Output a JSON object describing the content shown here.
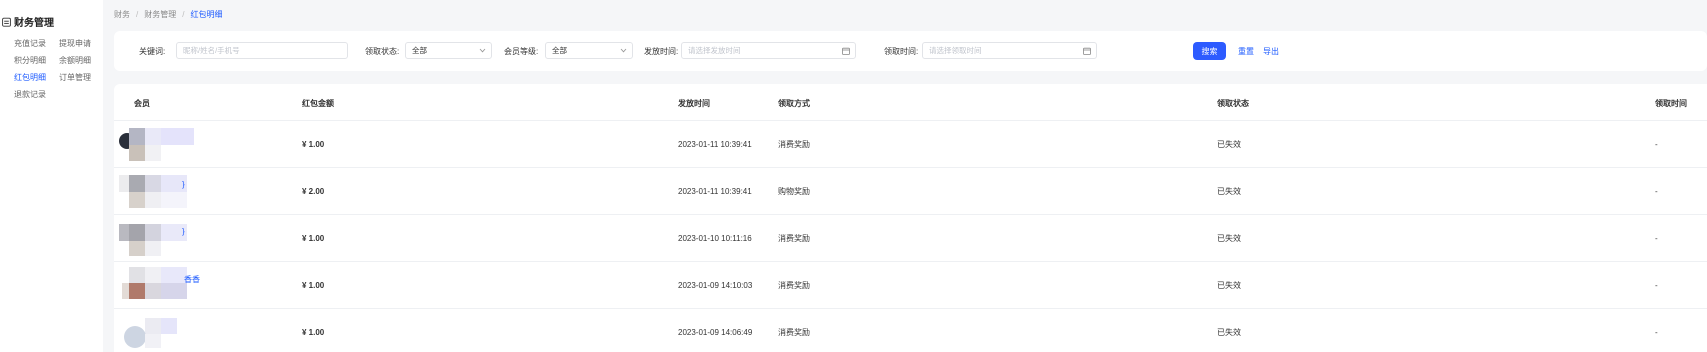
{
  "sidebar": {
    "title": "财务管理",
    "items": [
      {
        "label": "充值记录",
        "active": false
      },
      {
        "label": "提现申请",
        "active": false
      },
      {
        "label": "积分明细",
        "active": false
      },
      {
        "label": "余额明细",
        "active": false
      },
      {
        "label": "红包明细",
        "active": true
      },
      {
        "label": "订单管理",
        "active": false
      },
      {
        "label": "退款记录",
        "active": false
      }
    ]
  },
  "breadcrumb": [
    "财务",
    "财务管理",
    "红包明细"
  ],
  "filters": {
    "keyword_label": "关键词:",
    "keyword_placeholder": "昵称/姓名/手机号",
    "claim_status_label": "领取状态:",
    "claim_status_value": "全部",
    "member_level_label": "会员等级:",
    "member_level_value": "全部",
    "issue_time_label": "发放时间:",
    "issue_time_placeholder": "请选择发放时间",
    "claim_time_label": "领取时间:",
    "claim_time_placeholder": "请选择领取时间",
    "search_label": "搜索",
    "reset_label": "重置",
    "export_label": "导出"
  },
  "table": {
    "headers": [
      "会员",
      "红包金额",
      "发放时间",
      "领取方式",
      "领取状态",
      "领取时间"
    ],
    "rows": [
      {
        "member_suffix": "",
        "amount": "¥ 1.00",
        "issue_time": "2023-01-11 10:39:41",
        "method": "消费奖励",
        "status": "已失效",
        "claim_time": "-"
      },
      {
        "member_suffix": "}",
        "amount": "¥ 2.00",
        "issue_time": "2023-01-11 10:39:41",
        "method": "购物奖励",
        "status": "已失效",
        "claim_time": "-"
      },
      {
        "member_suffix": "}",
        "amount": "¥ 1.00",
        "issue_time": "2023-01-10 10:11:16",
        "method": "消费奖励",
        "status": "已失效",
        "claim_time": "-"
      },
      {
        "member_suffix": "香香",
        "amount": "¥ 1.00",
        "issue_time": "2023-01-09 14:10:03",
        "method": "消费奖励",
        "status": "已失效",
        "claim_time": "-"
      },
      {
        "member_suffix": "",
        "amount": "¥ 1.00",
        "issue_time": "2023-01-09 14:06:49",
        "method": "消费奖励",
        "status": "已失效",
        "claim_time": "-"
      }
    ]
  },
  "colors": {
    "accent": "#2d5bff",
    "link": "#1e5bff",
    "background": "#f5f6f8"
  }
}
